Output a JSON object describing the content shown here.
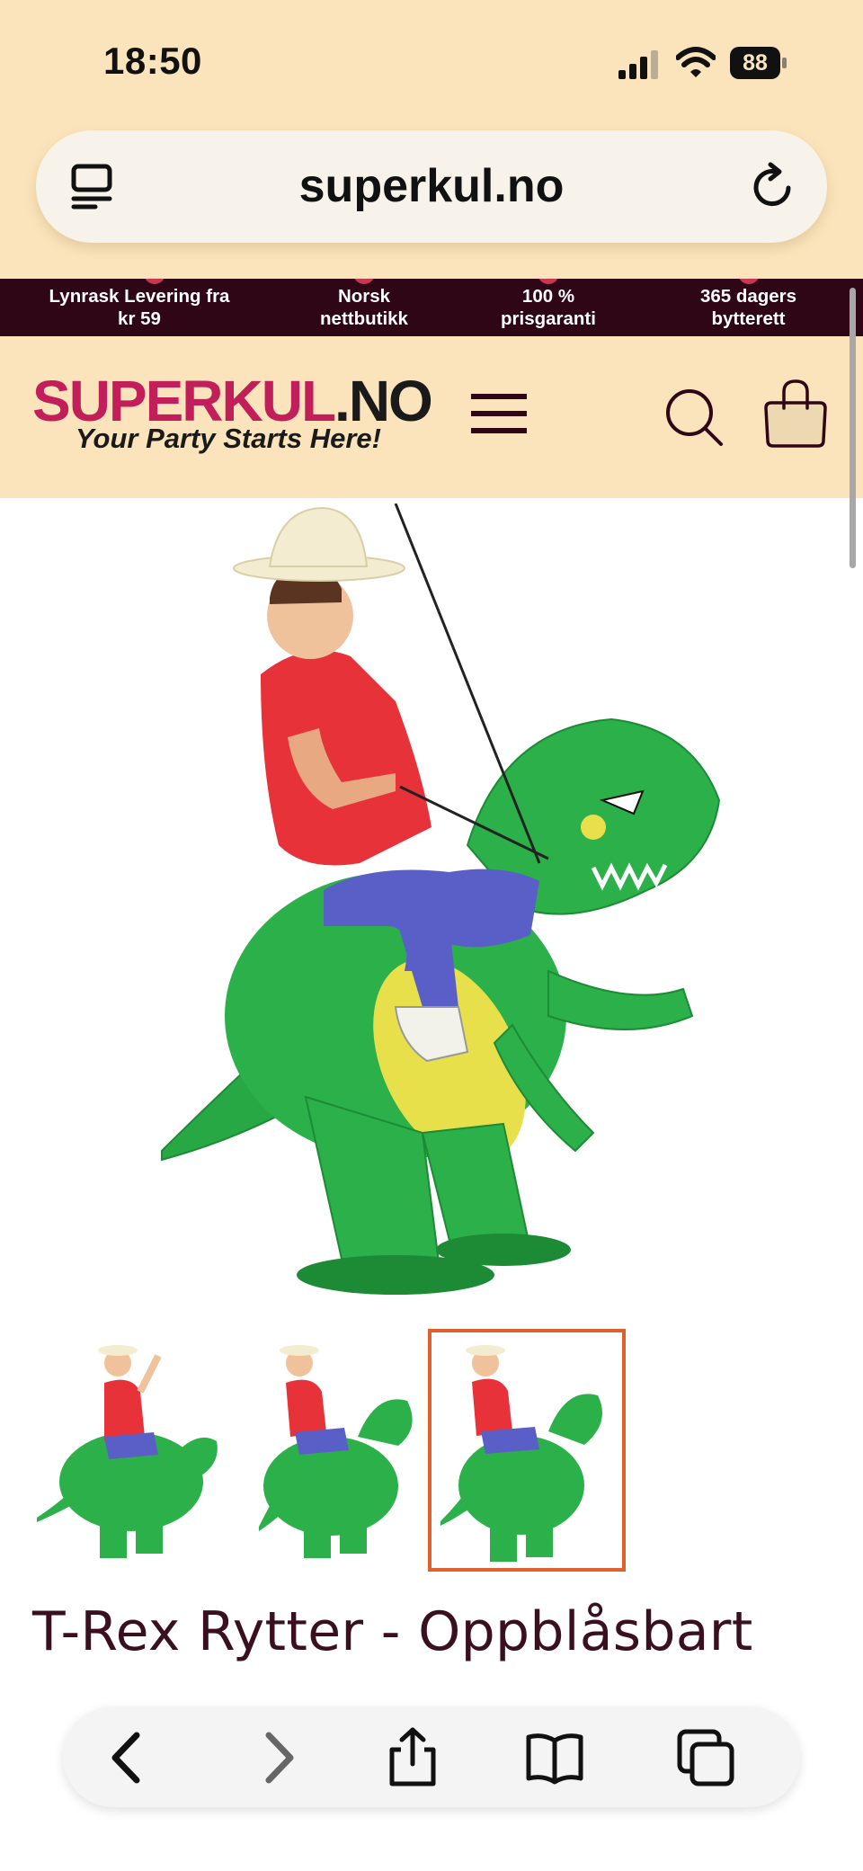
{
  "status": {
    "time": "18:50",
    "battery": "88"
  },
  "browser": {
    "url": "superkul.no"
  },
  "usp": [
    {
      "line1": "Lynrask Levering fra",
      "line2": "kr 59"
    },
    {
      "line1": "Norsk",
      "line2": "nettbutikk"
    },
    {
      "line1": "100 %",
      "line2": "prisgaranti"
    },
    {
      "line1": "365 dagers",
      "line2": "bytterett"
    }
  ],
  "logo": {
    "brand_part1": "SUPERKUL",
    "brand_part2": ".NO",
    "tagline": "Your Party Starts Here!"
  },
  "product": {
    "title": "T-Rex Rytter - Oppblåsbart",
    "thumbnails_count": 3,
    "active_thumbnail": 3
  },
  "colors": {
    "header_bg": "#fbe4bb",
    "usp_bg": "#2e0615",
    "accent": "#e0622a",
    "brand_pink": "#c21f5a"
  }
}
